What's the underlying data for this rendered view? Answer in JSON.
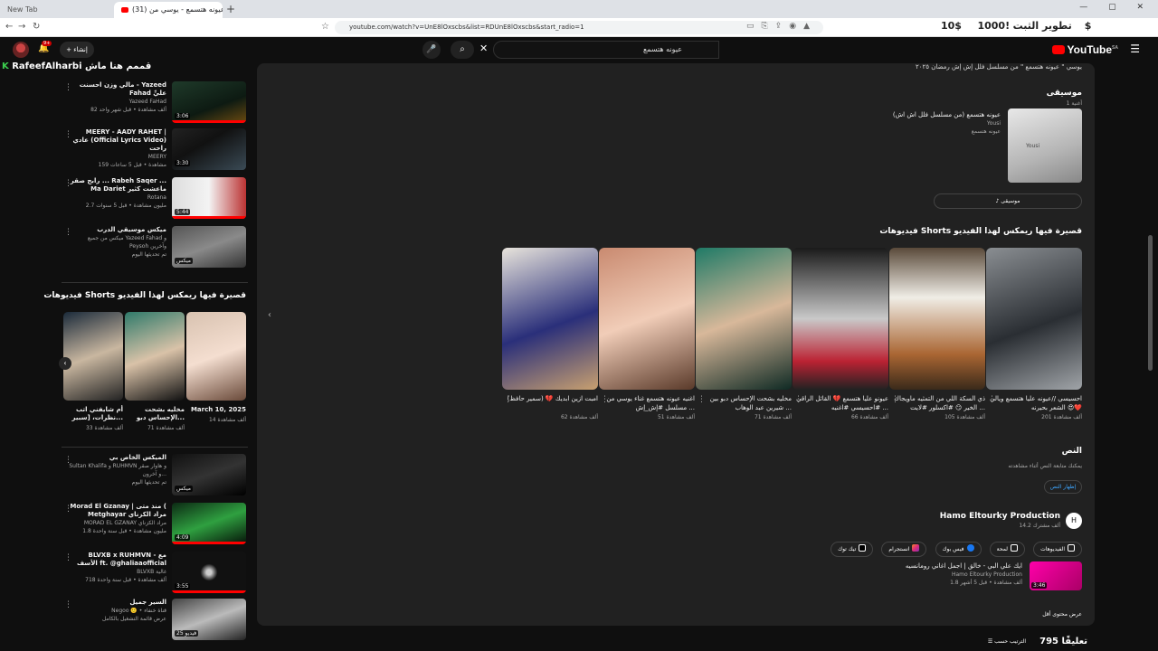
{
  "browser": {
    "tab_new_label": "New Tab",
    "tab_active_label": "(31) عيونه هتسمع - يوسي من...",
    "url": "youtube.com/watch?v=UnE8lOxscbs&list=RDUnE8lOxscbs&start_radio=1"
  },
  "tray": {
    "stat1": "!1000$",
    "stat2": "تطوير الثبت",
    "stat3": "10$"
  },
  "header": {
    "logo": "YouTube",
    "logo_region": "SA",
    "search_value": "عيونه هتسمع",
    "create_label": "إنشاء",
    "notif_count": "9+"
  },
  "overlay": {
    "badge": "K",
    "name": "RafeefAlharbi",
    "suffix": "قممم هنا ماش"
  },
  "sidebar": {
    "videos": [
      {
        "title": "مالي وزن احسنت - Yazeed Fahad عليِّ",
        "channel": "Yazeed FaHad",
        "meta": "82 ألف مشاهدة • قبل شهر واحد",
        "duration": "3:06"
      },
      {
        "title": "MEERY - AADY RAHET | عادي (Official Lyrics Video) راحت",
        "channel": "MEERY",
        "meta": "159 مشاهدة • قبل 5 ساعات",
        "duration": "3:30"
      },
      {
        "title": "رابح صقر ... Rabeh Saqer ... Ma Dariet ماعشت كثير",
        "channel": "Rotana",
        "meta": "2.7 مليون مشاهدة • قبل 5 سنوات",
        "duration": "5:44"
      },
      {
        "title": "ميكس موسيقي الدرب",
        "channel": "ميكس من جميع Yazeed Fahad و Peysoh وآخرين",
        "meta": "تم تحديثها اليوم",
        "duration": "ميكس"
      }
    ],
    "shorts_title": "فيديوهات Shorts قصيرة فيها ريمكس لهذا الفيديو",
    "shorts": [
      {
        "title": "March 10, 2025",
        "views": "14 ألف مشاهدة"
      },
      {
        "title": "مخليه بشحت الإحساس دبو...",
        "views": "71 ألف مشاهدة"
      },
      {
        "title": "أم شايفني اتب نظرات، [سبير...",
        "views": "33 ألف مشاهدة"
      }
    ],
    "videos2": [
      {
        "title": "الميكس الخاص بي",
        "channel": "Sultan Khalifa و RUHMVN و هاوار صقر و آخرون...",
        "meta": "تم تحديثها اليوم",
        "duration": "ميكس"
      },
      {
        "title": "Morad El Gzanay | منذ متى ( Metghayar مراد الكزناي",
        "channel": "MORAD EL GZANAY مراد الكزناي",
        "meta": "1.8 مليون مشاهدة • قبل سنة واحدة",
        "duration": "4:09"
      },
      {
        "title": "BLVXB x RUHMVN - مع الأسف ft. @ghaliaaofficial",
        "channel": "BLVXB غالية",
        "meta": "718 ألف مشاهدة • قبل سنة واحدة",
        "duration": "3:55"
      },
      {
        "title": "السير جميل",
        "channel": "Negoo 🙂 • قناة خنفاء",
        "meta": "عرض قائمة التشغيل بالكامل",
        "duration": "25 فيديو"
      }
    ]
  },
  "main": {
    "desc_line": "يوسي \" عيونه هتسمع \" من مسلسل فلل إش إش رمضان ٢٠٢٥",
    "music_heading": "موسيقى",
    "music_count": "1 أغنية",
    "music_song": "عيونه هتسمع (من مسلسل فلل اش اش)",
    "music_artist": "Yousi",
    "music_album": "عيونه هتسمع",
    "music_card_label": "Yousi",
    "music_button": "موسيقى",
    "shorts_heading": "فيديوهات Shorts قصيرة فيها ريمكس لهذا الفيديو",
    "shorts": [
      {
        "title": "امبت ازين ابديك 💔 (سمير حافظ)",
        "views": "62 ألف مشاهدة"
      },
      {
        "title": "اغنيه عيونه هتسمع غناء يوسي من مسلسل #إش_إش ...",
        "views": "51 ألف مشاهدة"
      },
      {
        "title": "مخليه بشحت الإحساس دبو بين شيرين عبد الوهاب ...",
        "views": "71 ألف مشاهدة"
      },
      {
        "title": "عيونو عليا هتسمع 💔 القائل الراقي #احسيسي #اغنيه ...",
        "views": "66 ألف مشاهدة"
      },
      {
        "title": "ذي السكة اللي من التمثيه ماويجاك الخير 😏 #اكسلور #لايت ...",
        "views": "105 ألف مشاهدة"
      },
      {
        "title": "احسيسي //عيونه عليا هتسمع ويالي الشعر بحيرنه 😍❤️",
        "views": "201 ألف مشاهدة"
      }
    ],
    "transcript_heading": "النص",
    "transcript_sub": "يمكنك متابعة النص أثناء مشاهدته",
    "transcript_button": "إظهار النص",
    "channel_logo": "H",
    "channel_name": "Hamo Eltourky Production",
    "channel_subs": "14.2 ألف مشترك",
    "links": [
      "الفيديوهات",
      "لمحة",
      "فيس بوك",
      "انستجرام",
      "تيك توك"
    ],
    "featured_title": "ايك علي البي - خالق | اجمل اغاني رومانسيه",
    "featured_channel": "Hamo Eltourky Production",
    "featured_meta": "1.8 ألف مشاهدة • قبل 5 أشهر",
    "featured_duration": "3:46",
    "more_videos": "عرض محتوى أقل"
  },
  "comments": {
    "count": "795 تعليقًا",
    "sort": "الترتيب حسب"
  }
}
